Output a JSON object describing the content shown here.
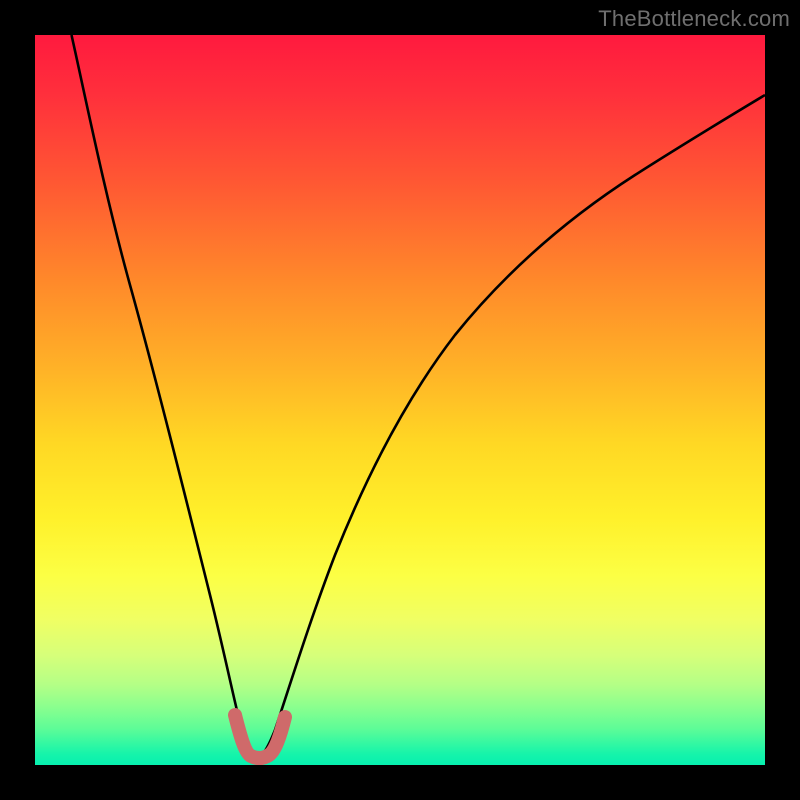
{
  "branding": {
    "watermark": "TheBottleneck.com"
  },
  "colors": {
    "frame": "#000000",
    "curve": "#000000",
    "valley_highlight": "#cf6a6a",
    "gradient_top": "#ff1a3e",
    "gradient_bottom": "#07f0b0"
  },
  "chart_data": {
    "type": "line",
    "title": "",
    "xlabel": "",
    "ylabel": "",
    "xlim": [
      0,
      100
    ],
    "ylim": [
      0,
      100
    ],
    "grid": false,
    "legend": false,
    "series": [
      {
        "name": "bottleneck-curve",
        "x": [
          5,
          8,
          12,
          15,
          18,
          20,
          22,
          24,
          26,
          27,
          28,
          29,
          30,
          31,
          33,
          36,
          40,
          45,
          50,
          55,
          60,
          65,
          70,
          75,
          80,
          85,
          90,
          95,
          100
        ],
        "y": [
          100,
          86,
          70,
          58,
          45,
          36,
          27,
          18,
          10,
          5,
          2,
          1,
          1,
          2,
          6,
          14,
          25,
          37,
          47,
          55,
          62,
          67,
          72,
          76,
          79,
          82,
          84,
          86,
          88
        ]
      },
      {
        "name": "valley-highlight",
        "x": [
          26.5,
          27,
          27.5,
          28,
          28.5,
          29,
          29.5,
          30,
          30.5,
          31,
          31.5,
          32,
          32.8
        ],
        "y": [
          6.5,
          4,
          2.2,
          1.2,
          1,
          1,
          1,
          1.1,
          1.4,
          2,
          3,
          4.5,
          7
        ]
      }
    ]
  }
}
